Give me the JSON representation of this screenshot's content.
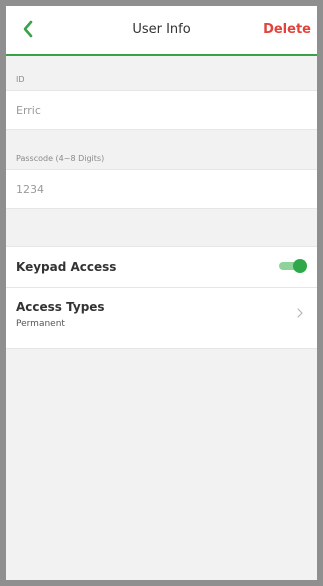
{
  "header": {
    "back_icon": "chevron-left-icon",
    "title": "User Info",
    "delete_label": "Delete",
    "accent_color": "#3aa14a",
    "danger_color": "#e2443c"
  },
  "form": {
    "id_label": "ID",
    "id_value": "Erric",
    "passcode_label": "Passcode (4~8 Digits)",
    "passcode_value": "1234"
  },
  "settings": {
    "keypad_access": {
      "label": "Keypad Access",
      "enabled": true
    },
    "access_types": {
      "label": "Access Types",
      "value": "Permanent",
      "chevron_icon": "chevron-right-icon"
    }
  }
}
